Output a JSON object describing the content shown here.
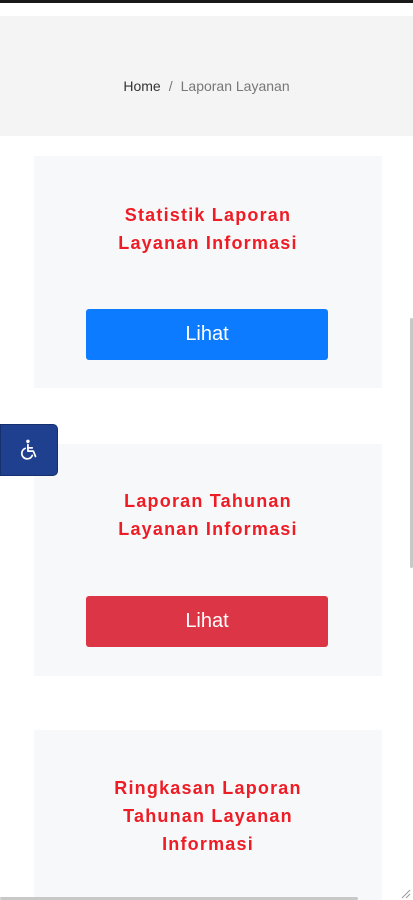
{
  "breadcrumb": {
    "home": "Home",
    "separator": "/",
    "current": "Laporan Layanan"
  },
  "cards": [
    {
      "title": "Statistik Laporan\nLayanan Informasi",
      "button_label": "Lihat",
      "button_color": "#0d7bff"
    },
    {
      "title": "Laporan Tahunan\nLayanan Informasi",
      "button_label": "Lihat",
      "button_color": "#dc3545"
    },
    {
      "title": "Ringkasan Laporan\nTahunan Layanan\nInformasi"
    }
  ],
  "accessibility": {
    "icon": "wheelchair-icon",
    "color": "#1f3f8f"
  },
  "colors": {
    "title_red": "#ee1c25",
    "header_band": "#f4f4f4",
    "card_bg": "#f7f8f9"
  }
}
